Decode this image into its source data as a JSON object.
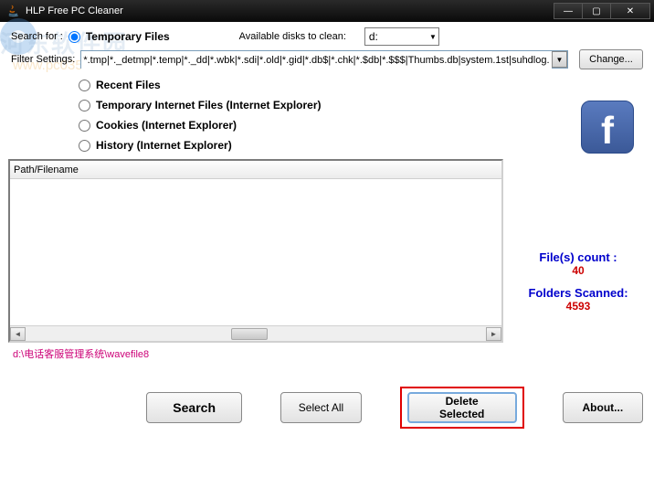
{
  "titlebar": {
    "title": "HLP Free PC Cleaner"
  },
  "search": {
    "label": "Search for :",
    "main_option": "Temporary Files"
  },
  "disks": {
    "label": "Available disks to clean:",
    "selected": "d:"
  },
  "filter": {
    "label": "Filter Settings:",
    "value": "*.tmp|*._detmp|*.temp|*._dd|*.wbk|*.sdi|*.old|*.gid|*.db$|*.chk|*.$db|*.$$$|Thumbs.db|system.1st|suhdlog.",
    "change_btn": "Change..."
  },
  "options": [
    "Recent Files",
    "Temporary Internet Files (Internet Explorer)",
    "Cookies  (Internet Explorer)",
    "History  (Internet Explorer)"
  ],
  "table": {
    "header": "Path/Filename"
  },
  "stats": {
    "files_label": "File(s) count :",
    "files_value": "40",
    "folders_label": "Folders Scanned:",
    "folders_value": "4593"
  },
  "status_path": "d:\\电话客服管理系统\\wavefile8",
  "buttons": {
    "search": "Search",
    "select_all": "Select All",
    "delete_selected": "Delete Selected",
    "about": "About..."
  },
  "watermark": {
    "text": "河东软件园",
    "url": "www.pc0359.cn"
  }
}
